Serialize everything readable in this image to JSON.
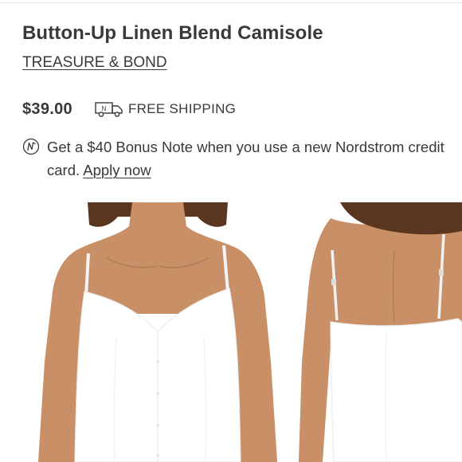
{
  "product": {
    "title": "Button-Up Linen Blend Camisole",
    "brand": "TREASURE & BOND",
    "price": "$39.00",
    "shipping_label": "FREE SHIPPING",
    "shipping_icon_letter": "N"
  },
  "promo": {
    "text": "Get a $40 Bonus Note when you use a new Nordstrom credit card. ",
    "link_label": "Apply now",
    "icon": "nordstrom-note-icon"
  },
  "gallery": {
    "images": [
      {
        "view": "front",
        "icon": "product-photo-front"
      },
      {
        "view": "back",
        "icon": "product-photo-back"
      }
    ]
  },
  "colors": {
    "text": "#393939",
    "skin": "#c98f66",
    "hair": "#5a3620",
    "garment": "#ffffff"
  }
}
